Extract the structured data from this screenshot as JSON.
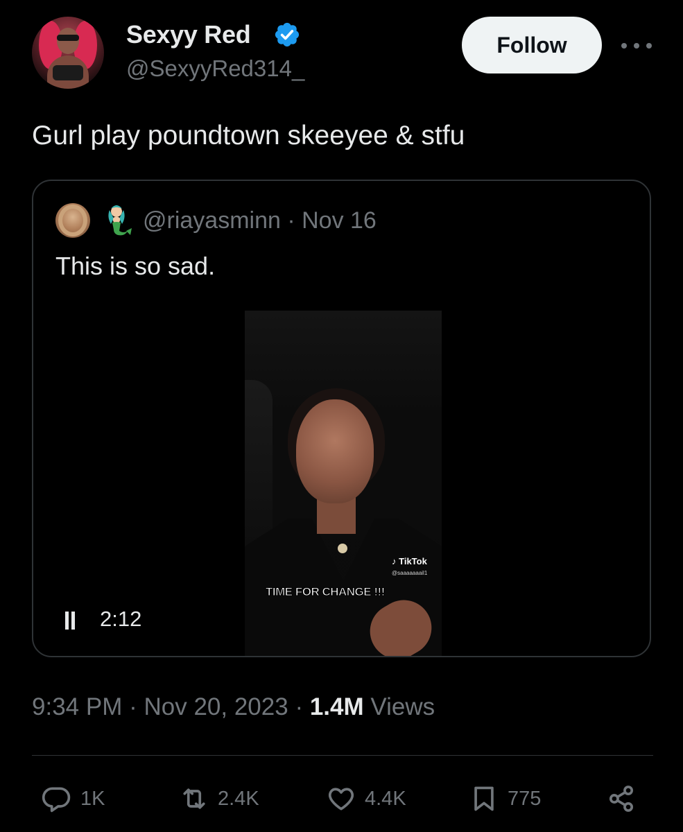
{
  "tweet": {
    "display_name": "Sexyy Red",
    "handle": "@SexyyRed314_",
    "follow_label": "Follow",
    "text": "Gurl play poundtown skeeyee & stfu",
    "time": "9:34 PM",
    "separator": "·",
    "date": "Nov 20, 2023",
    "views_count": "1.4M",
    "views_label": "Views",
    "verified_color": "#1d9bf0"
  },
  "quote": {
    "handle_line": "@riayasminn · Nov 16",
    "text": "This is so sad.",
    "video": {
      "duration": "2:12",
      "caption": "TIME FOR CHANGE !!!",
      "tiktok_logo": "TikTok",
      "tiktok_user": "@saaaaaaail1"
    }
  },
  "actions": {
    "reply_count": "1K",
    "retweet_count": "2.4K",
    "like_count": "4.4K",
    "bookmark_count": "775"
  },
  "icons": {
    "verified": "verified-badge-icon",
    "more": "more-icon",
    "mermaid": "mermaid-emoji-icon",
    "pause": "pause-icon",
    "reply": "reply-icon",
    "retweet": "retweet-icon",
    "like": "heart-icon",
    "bookmark": "bookmark-icon",
    "share": "share-icon"
  },
  "colors": {
    "background": "#000000",
    "text_primary": "#e7e9ea",
    "text_secondary": "#71767b",
    "border": "#2f3336",
    "follow_bg": "#eff3f4"
  }
}
